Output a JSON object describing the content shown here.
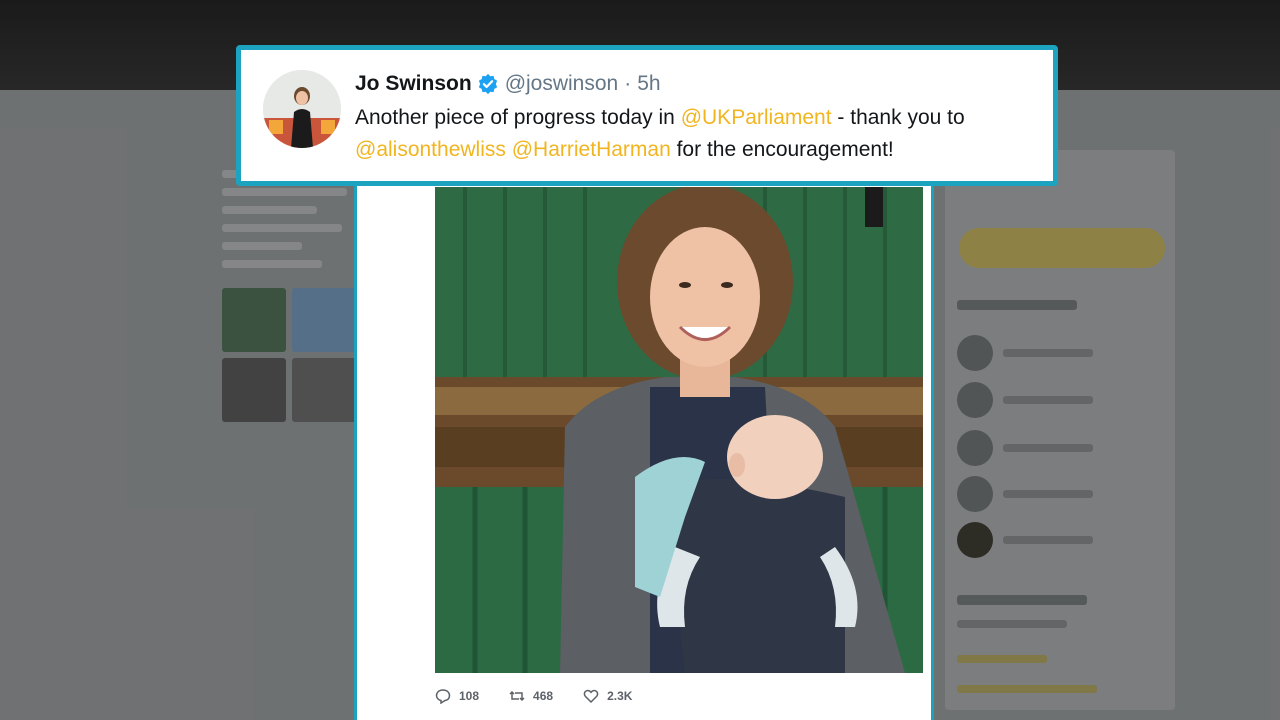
{
  "tweet": {
    "author_name": "Jo Swinson",
    "handle": "@joswinson",
    "separator": "·",
    "time": "5h",
    "text_part1": "Another piece of progress today in ",
    "mention1": "@UKParliament",
    "text_part2": " - thank you to ",
    "mention2": "@alisonthewliss",
    "text_part3": " ",
    "mention3": "@HarrietHarman",
    "text_part4": " for the encouragement!",
    "replies": "108",
    "retweets": "468",
    "likes": "2.3K"
  },
  "colors": {
    "accent_border": "#1ba3c0",
    "mention": "#f1b51f",
    "verified": "#1da1f2",
    "bench_green": "#2f6e47"
  },
  "icons": [
    "verified-badge-icon",
    "reply-icon",
    "retweet-icon",
    "like-icon"
  ]
}
